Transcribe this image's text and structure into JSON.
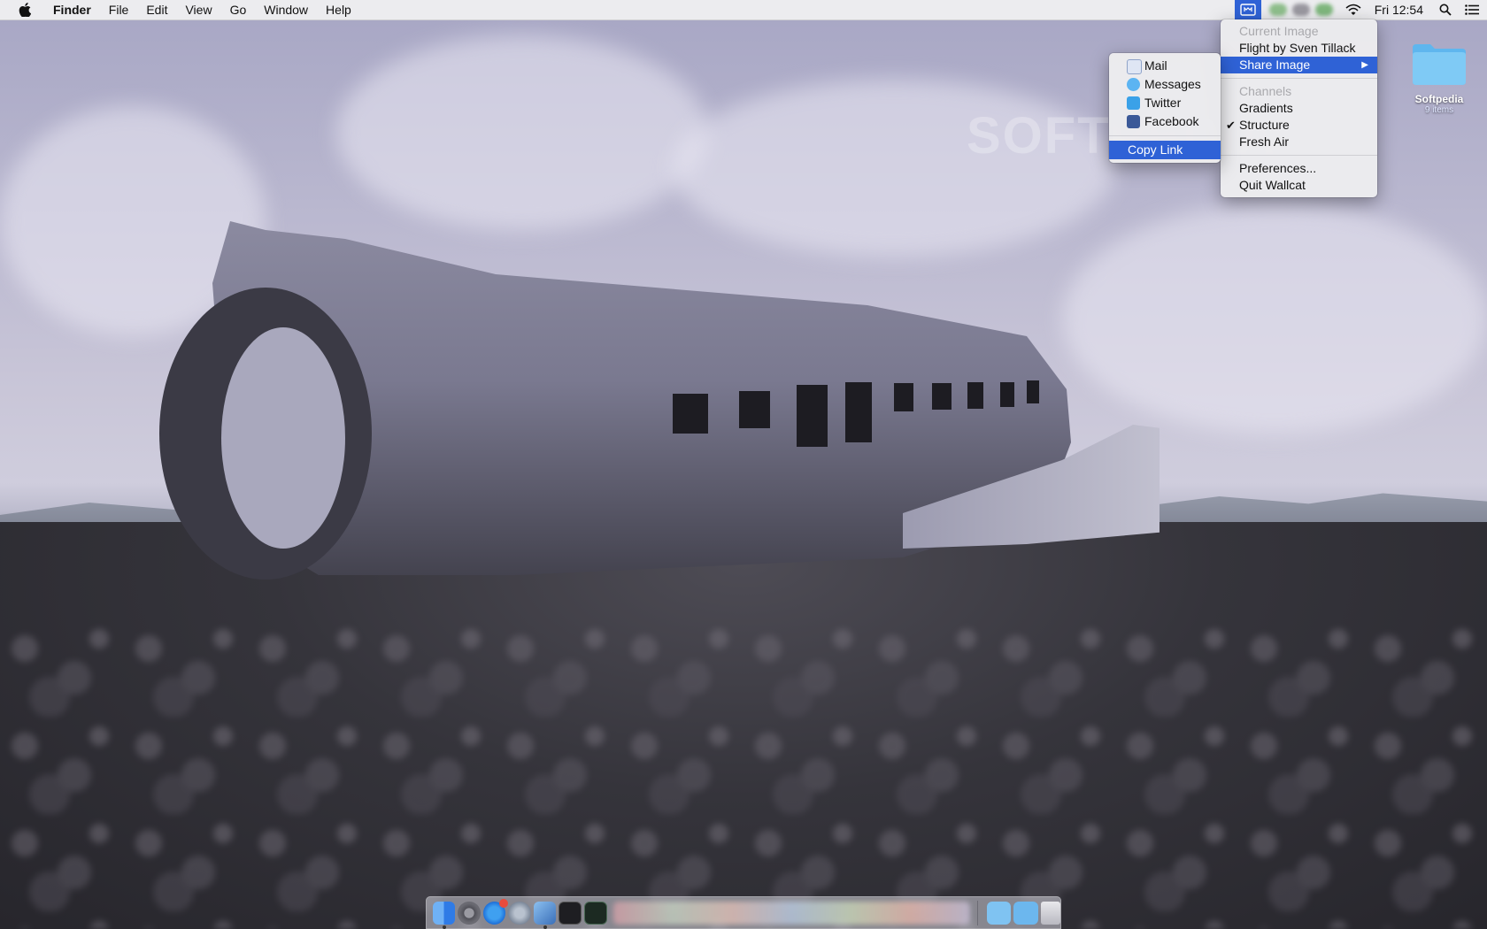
{
  "menubar": {
    "app_name": "Finder",
    "menus": [
      "File",
      "Edit",
      "View",
      "Go",
      "Window",
      "Help"
    ],
    "clock": "Fri 12:54"
  },
  "wallcat_menu": {
    "current_image_header": "Current Image",
    "image_title": "Flight by Sven Tillack",
    "share_image": "Share Image",
    "channels_header": "Channels",
    "channels": [
      "Gradients",
      "Structure",
      "Fresh Air"
    ],
    "checked_channel": "Structure",
    "preferences": "Preferences...",
    "quit": "Quit Wallcat"
  },
  "share_menu": {
    "items": [
      "Mail",
      "Messages",
      "Twitter",
      "Facebook"
    ],
    "copy_link": "Copy Link"
  },
  "desktop": {
    "folder_name": "Softpedia",
    "folder_count": "9 items"
  },
  "watermark": "SOFTPEDIA",
  "colors": {
    "accent": "#2f62d6",
    "folder": "#6fc3f2"
  }
}
